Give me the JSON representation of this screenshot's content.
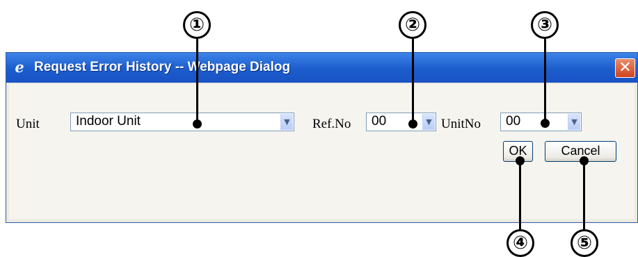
{
  "dialog": {
    "title": "Request Error History -- Webpage Dialog",
    "icon": "ie-page-icon",
    "close_glyph": "✕"
  },
  "form": {
    "unit_label": "Unit",
    "unit_value": "Indoor Unit",
    "refno_label": "Ref.No",
    "refno_value": "00",
    "unitno_label": "UnitNo",
    "unitno_value": "00",
    "ok_label": "OK",
    "cancel_label": "Cancel"
  },
  "callouts": [
    "①",
    "②",
    "③",
    "④",
    "⑤"
  ]
}
